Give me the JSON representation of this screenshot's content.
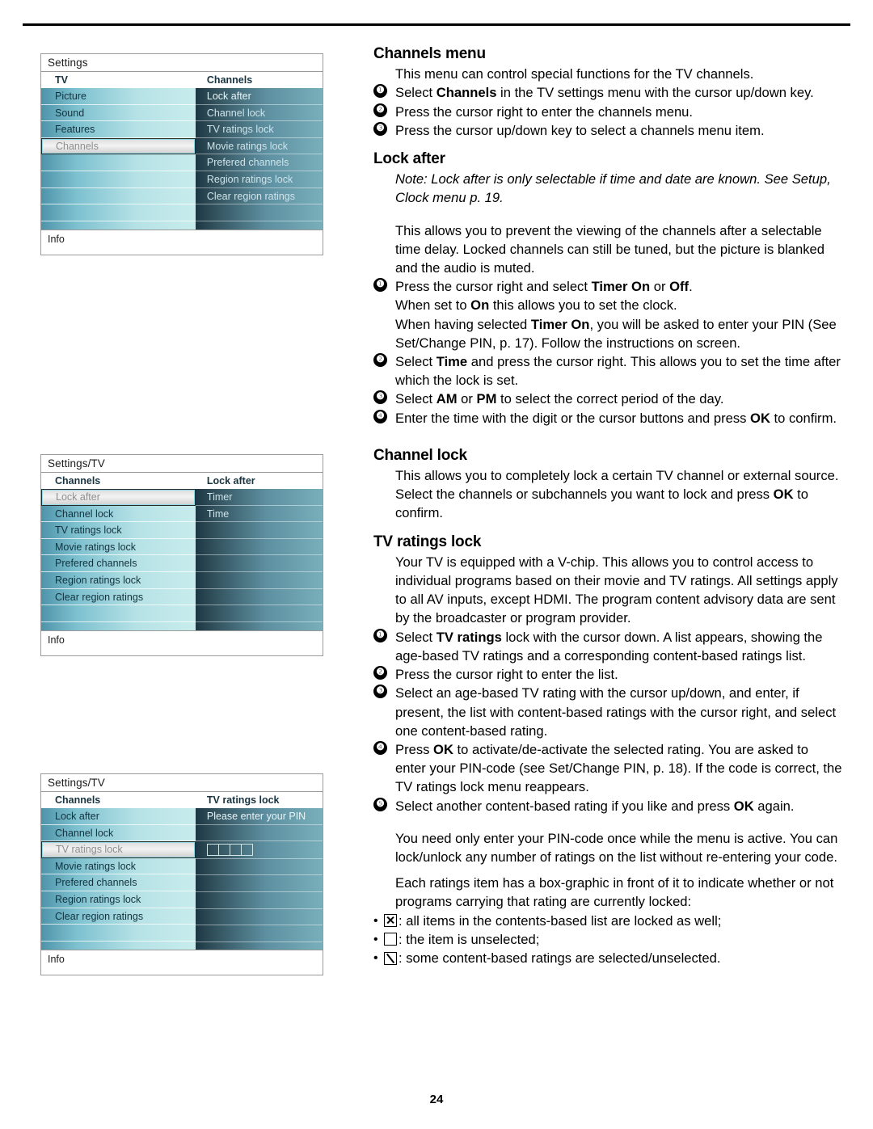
{
  "page": {
    "number": "24"
  },
  "menus": [
    {
      "title": "Settings",
      "left_header": "TV",
      "right_header": "Channels",
      "left_items": [
        {
          "label": "Picture",
          "selected": false
        },
        {
          "label": "Sound",
          "selected": false
        },
        {
          "label": "Features",
          "selected": false
        },
        {
          "label": "Channels",
          "selected": true
        }
      ],
      "left_blank_rows": 4,
      "right_items": [
        {
          "label": "Lock after",
          "highlight": true
        },
        {
          "label": "Channel lock",
          "highlight": false
        },
        {
          "label": "TV ratings lock",
          "highlight": false
        },
        {
          "label": "Movie ratings lock",
          "highlight": false
        },
        {
          "label": "Prefered channels",
          "highlight": false
        },
        {
          "label": "Region ratings lock",
          "highlight": false
        },
        {
          "label": "Clear region ratings",
          "highlight": false
        }
      ],
      "right_blank_rows": 1,
      "info_label": "Info"
    },
    {
      "title": "Settings/TV",
      "left_header": "Channels",
      "right_header": "Lock after",
      "left_items": [
        {
          "label": "Lock after",
          "selected": true
        },
        {
          "label": "Channel lock",
          "selected": false
        },
        {
          "label": "TV ratings lock",
          "selected": false
        },
        {
          "label": "Movie ratings lock",
          "selected": false
        },
        {
          "label": "Prefered channels",
          "selected": false
        },
        {
          "label": "Region ratings lock",
          "selected": false
        },
        {
          "label": "Clear region ratings",
          "selected": false
        }
      ],
      "left_blank_rows": 1,
      "right_items": [
        {
          "label": "Timer",
          "highlight": false
        },
        {
          "label": "Time",
          "highlight": false
        }
      ],
      "right_blank_rows": 6,
      "info_label": "Info"
    },
    {
      "title": "Settings/TV",
      "left_header": "Channels",
      "right_header": "TV ratings lock",
      "left_items": [
        {
          "label": "Lock after",
          "selected": false
        },
        {
          "label": "Channel lock",
          "selected": false
        },
        {
          "label": "TV ratings lock",
          "selected": true
        },
        {
          "label": "Movie ratings lock",
          "selected": false
        },
        {
          "label": "Prefered channels",
          "selected": false
        },
        {
          "label": "Region ratings lock",
          "selected": false
        },
        {
          "label": "Clear region ratings",
          "selected": false
        }
      ],
      "left_blank_rows": 1,
      "right_prompt": "Please enter your PIN",
      "pin_boxes": 4,
      "info_label": "Info"
    }
  ],
  "content": {
    "h_channels_menu": "Channels menu",
    "intro": "This menu can control special functions for the TV channels.",
    "step1_a": "Select ",
    "step1_b": "Channels",
    "step1_c": " in the TV settings menu with the cursor up/down key.",
    "step2": "Press the cursor right to enter the channels menu.",
    "step3": "Press the cursor up/down key to select a channels menu item.",
    "h_lock_after": "Lock after",
    "note_lock_after": "Note: Lock after is only selectable if time and date are known. See Setup, Clock menu p. 19.",
    "lock_after_body": "This allows you to prevent the viewing of the channels after a selectable time delay. Locked channels can still be tuned, but the picture is blanked and the audio is muted.",
    "la_s1_a": "Press the cursor right and select ",
    "la_s1_b": "Timer On",
    "la_s1_c": " or ",
    "la_s1_d": "Off",
    "la_s1_e": ".",
    "la_s1_line2_a": "When set to ",
    "la_s1_line2_b": "On",
    "la_s1_line2_c": " this allows you to set the clock.",
    "la_s1_line3_a": "When having selected ",
    "la_s1_line3_b": "Timer On",
    "la_s1_line3_c": ", you will be asked to enter your PIN (See Set/Change PIN, p. 17). Follow the instructions on screen.",
    "la_s2_a": "Select ",
    "la_s2_b": "Time",
    "la_s2_c": " and press the cursor right. This allows you to set the time after which the lock is set.",
    "la_s3_a": "Select ",
    "la_s3_b": "AM",
    "la_s3_c": " or ",
    "la_s3_d": "PM",
    "la_s3_e": " to select the correct period of the day.",
    "la_s4_a": "Enter the time with the digit or the cursor buttons and press ",
    "la_s4_b": "OK",
    "la_s4_c": " to confirm.",
    "h_channel_lock": "Channel lock",
    "cl_body_a": "This allows you to completely lock a certain TV channel or external source. Select the channels or subchannels you want to lock and press ",
    "cl_body_b": "OK",
    "cl_body_c": " to confirm.",
    "h_tv_ratings_lock": "TV ratings lock",
    "tr_body": "Your TV is equipped with a V-chip. This allows you to control access to individual programs based on their movie and TV ratings. All settings apply to all AV inputs, except HDMI. The program content advisory data are sent by the broadcaster or program provider.",
    "tr_s1_a": "Select ",
    "tr_s1_b": "TV ratings",
    "tr_s1_c": " lock with the cursor down. A list appears, showing the age-based TV ratings and a corresponding content-based ratings list.",
    "tr_s2": "Press the cursor right to enter the list.",
    "tr_s3": "Select an age-based TV rating with the cursor up/down, and enter, if present, the list with content-based ratings with the cursor right, and select one content-based rating.",
    "tr_s4_a": "Press ",
    "tr_s4_b": "OK",
    "tr_s4_c": " to activate/de-activate the selected rating. You are asked to enter your PIN-code (see Set/Change PIN, p. 18). If the code is correct, the TV ratings lock menu reappears.",
    "tr_s5_a": "Select another content-based rating if you like and press ",
    "tr_s5_b": "OK",
    "tr_s5_c": " again.",
    "pin_note": "You need only enter your PIN-code once while the menu is active. You can lock/unlock any number of ratings on the list without re-entering your code.",
    "box_intro": "Each ratings item has a box-graphic in front of it to indicate whether or not programs carrying that rating are currently locked:",
    "bullet_x": ": all items in the contents-based list are locked as well;",
    "bullet_empty": ": the item is unselected;",
    "bullet_slash": ": some content-based ratings are selected/unselected.",
    "num1": "❶",
    "num2": "❷",
    "num3": "❸",
    "num4": "❹",
    "num5": "❺"
  },
  "colors": {
    "menu_left_light": "#c8ecec",
    "menu_left_dark": "#4e93a9",
    "menu_right_dark": "#1d3744",
    "menu_right_light": "#79afbb",
    "selected_text": "#8e8e8e",
    "rule": "#000000"
  }
}
